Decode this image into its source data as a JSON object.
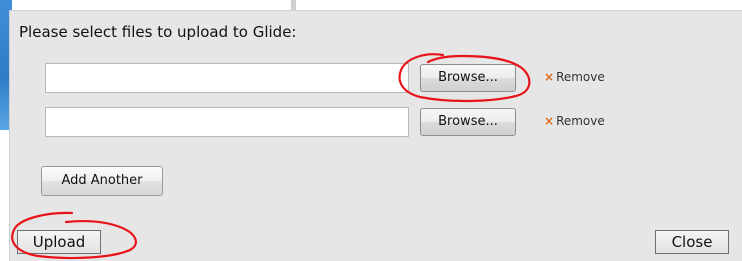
{
  "dialog": {
    "prompt": "Please select files to upload to Glide:"
  },
  "file_rows": [
    {
      "value": "",
      "browse_label": "Browse...",
      "remove_label": "Remove",
      "remove_icon": "x-icon"
    },
    {
      "value": "",
      "browse_label": "Browse...",
      "remove_label": "Remove",
      "remove_icon": "x-icon"
    }
  ],
  "actions": {
    "add_another_label": "Add Another",
    "upload_label": "Upload",
    "close_label": "Close"
  },
  "colors": {
    "dialog_bg": "#e6e6e6",
    "remove_icon": "#e06a1b",
    "annotation": "#e8141b"
  }
}
